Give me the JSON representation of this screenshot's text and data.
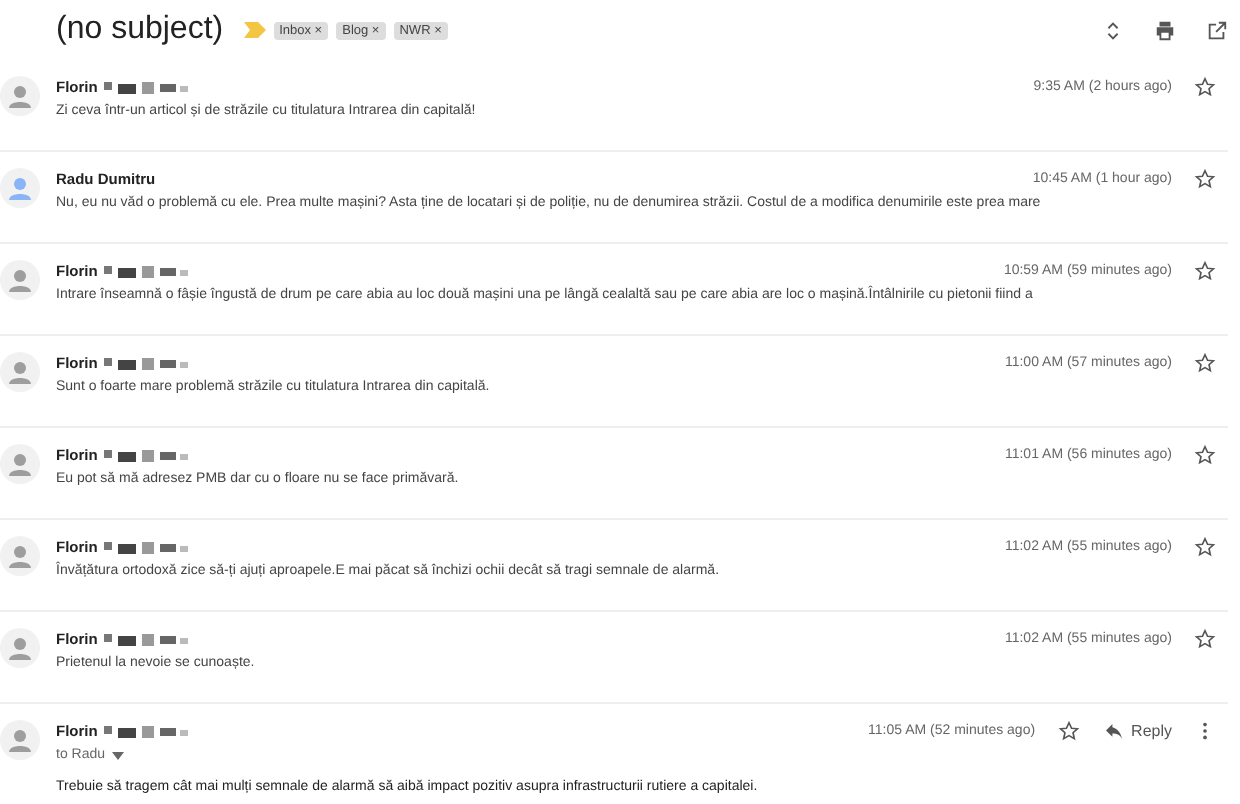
{
  "subject": "(no subject)",
  "labels": [
    {
      "label": "Inbox ×"
    },
    {
      "label": "Blog ×"
    },
    {
      "label": "NWR ×"
    }
  ],
  "messages": [
    {
      "kind": "collapsed",
      "sender": "Florin",
      "color": "#9e9e9e",
      "time": "9:35 AM (2 hours ago)",
      "body": "Zi ceva într-un articol și de străzile cu titulatura Intrarea din capitală!"
    },
    {
      "kind": "collapsed",
      "sender": "Radu Dumitru",
      "color": "#8ab4f8",
      "time": "10:45 AM (1 hour ago)",
      "body": "Nu, eu nu văd o problemă cu ele. Prea multe mașini? Asta ține de locatari și de poliție, nu de denumirea străzii. Costul de a modifica denumirile este prea mare"
    },
    {
      "kind": "collapsed",
      "sender": "Florin",
      "color": "#9e9e9e",
      "time": "10:59 AM (59 minutes ago)",
      "body": "Intrare înseamnă o fâșie îngustă de drum pe care abia au loc două mașini una pe lângă cealaltă sau pe care abia are loc o mașină.Întâlnirile cu pietonii fiind a"
    },
    {
      "kind": "collapsed",
      "sender": "Florin",
      "color": "#9e9e9e",
      "time": "11:00 AM (57 minutes ago)",
      "body": "Sunt o foarte mare problemă străzile cu titulatura Intrarea din capitală."
    },
    {
      "kind": "collapsed",
      "sender": "Florin",
      "color": "#9e9e9e",
      "time": "11:01 AM (56 minutes ago)",
      "body": "Eu pot să mă adresez PMB dar cu o floare nu se face primăvară."
    },
    {
      "kind": "collapsed",
      "sender": "Florin",
      "color": "#9e9e9e",
      "time": "11:02 AM (55 minutes ago)",
      "body": "Învățătura ortodoxă zice să-ți ajuți aproapele.E mai păcat să închizi ochii decât să tragi semnale de alarmă."
    },
    {
      "kind": "collapsed",
      "sender": "Florin",
      "color": "#9e9e9e",
      "time": "11:02 AM (55 minutes ago)",
      "body": "Prietenul la nevoie se cunoaște."
    },
    {
      "kind": "expanded",
      "sender": "Florin",
      "color": "#9e9e9e",
      "time": "11:05 AM (52 minutes ago)",
      "recipient": "to Radu",
      "reply": "Reply",
      "body": "Trebuie să tragem cât mai mulți semnale de alarmă să aibă impact pozitiv asupra infrastructurii rutiere a capitalei."
    }
  ]
}
